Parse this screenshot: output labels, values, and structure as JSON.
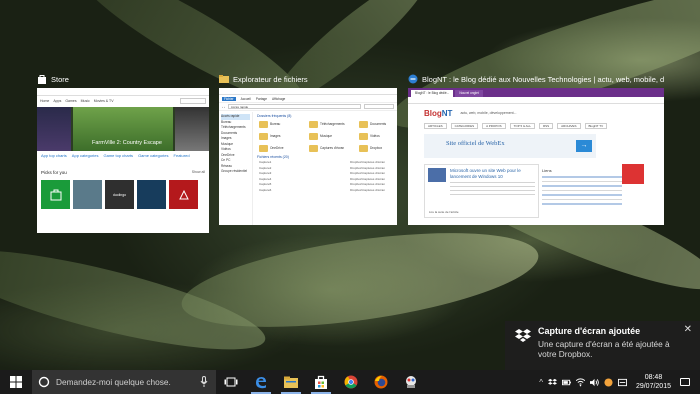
{
  "task_view": {
    "windows": [
      {
        "title": "Store",
        "icon": "store-bag-icon",
        "content": {
          "nav": [
            "Home",
            "Apps",
            "Games",
            "Music",
            "Movies & TV"
          ],
          "hero_title": "FarmVille 2: Country Escape",
          "categories": [
            "App top charts",
            "App categories",
            "Game top charts",
            "Game categories",
            "Featured"
          ],
          "picks_heading": "Picks for you",
          "show_all": "Show all",
          "tiles": [
            {
              "label": "",
              "color": "#1a9b3a"
            },
            {
              "label": "",
              "color": "#5a7a8a"
            },
            {
              "label": "duolingo",
              "color": "#2f2f2f"
            },
            {
              "label": "",
              "color": "#173c5c"
            },
            {
              "label": "",
              "color": "#b4191c"
            }
          ]
        }
      },
      {
        "title": "Explorateur de fichiers",
        "icon": "folder-icon",
        "content": {
          "ribbon": [
            "Fichier",
            "Accueil",
            "Partage",
            "Affichage"
          ],
          "address": "Accès rapide",
          "sidebar": [
            "Accès rapide",
            "Bureau",
            "Téléchargements",
            "Documents",
            "Images",
            "Musique",
            "Vidéos",
            "OneDrive",
            "Ce PC",
            "Réseau",
            "Groupe résidentiel"
          ],
          "frequent_heading": "Dossiers fréquents (8)",
          "folders": [
            "Bureau",
            "Téléchargements",
            "Documents",
            "Images",
            "Musique",
            "Vidéos",
            "OneDrive",
            "Captures d'écran",
            "Dropbox"
          ],
          "recent_heading": "Fichiers récents (20)",
          "recent_files": [
            {
              "name": "Capture1",
              "path": "Dropbox\\Captures d'écran"
            },
            {
              "name": "Capture2",
              "path": "Dropbox\\Captures d'écran"
            },
            {
              "name": "Capture3",
              "path": "Dropbox\\Captures d'écran"
            },
            {
              "name": "Capture4",
              "path": "Dropbox\\Captures d'écran"
            },
            {
              "name": "Capture5",
              "path": "Dropbox\\Captures d'écran"
            },
            {
              "name": "Capture6",
              "path": "Dropbox\\Captures d'écran"
            }
          ]
        }
      },
      {
        "title": "BlogNT : le Blog dédié aux Nouvelles Technologies | actu, web, mobile, déve...",
        "icon": "edge-icon",
        "content": {
          "tabs": [
            "BlogNT : le Blog dédié...",
            "Nouvel onglet"
          ],
          "logo_part1": "Blog",
          "logo_part2": "NT",
          "tagline": "actu, web, mobile, développement...",
          "menu": [
            "ARTICLES",
            "CATEGORIES",
            "A PROPOS",
            "TOP 5 & ALL",
            "RSS",
            "ARCHIVES",
            "BlogNT TV"
          ],
          "banner_title": "Site officiel de WebEx",
          "article_title": "Microsoft ouvre un site Web pour le lancement de Windows 10",
          "article_more": "Lire la suite de l'article",
          "sidebar_heading": "Liens"
        }
      }
    ]
  },
  "notification": {
    "app_icon": "dropbox-icon",
    "title": "Capture d'écran ajoutée",
    "body": "Une capture d'écran a été ajoutée à votre Dropbox.",
    "close_label": "✕"
  },
  "taskbar": {
    "search_placeholder": "Demandez-moi quelque chose.",
    "apps": [
      {
        "name": "edge-icon",
        "open": true
      },
      {
        "name": "file-explorer-icon",
        "open": true
      },
      {
        "name": "store-icon",
        "open": true
      },
      {
        "name": "chrome-icon",
        "open": false
      },
      {
        "name": "firefox-icon",
        "open": false
      },
      {
        "name": "app-icon",
        "open": false
      }
    ],
    "clock_time": "08:48",
    "clock_date": "29/07/2015"
  }
}
